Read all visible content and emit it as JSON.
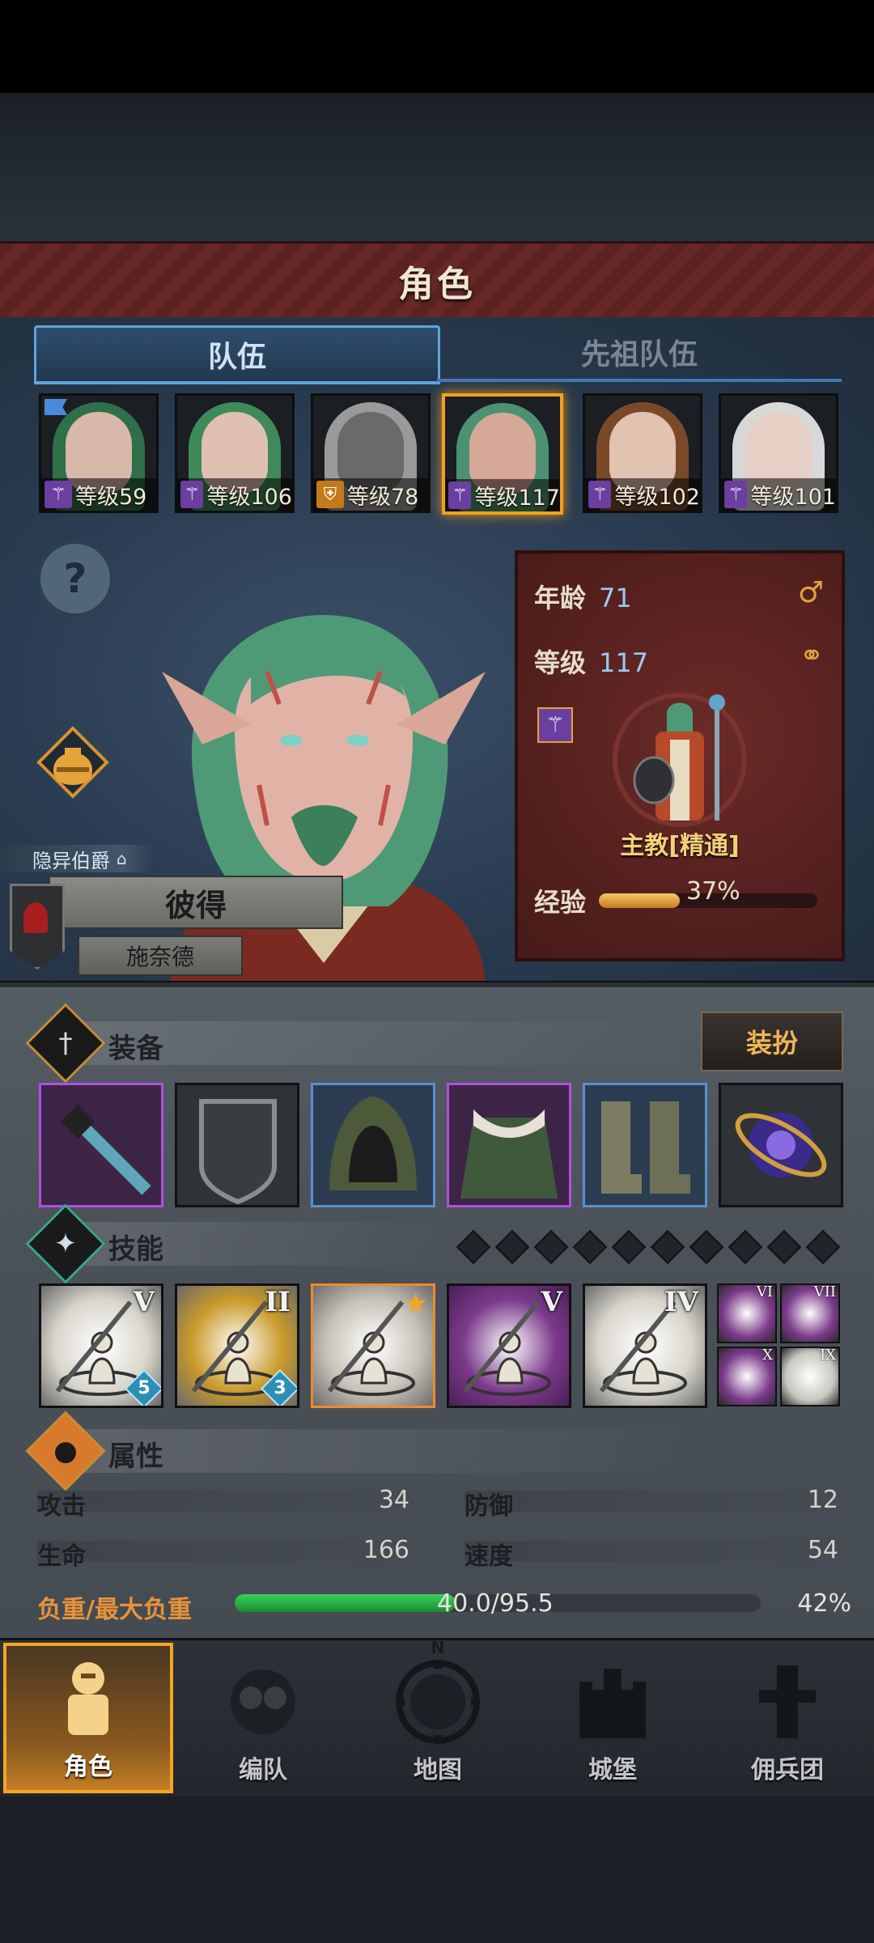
{
  "header": {
    "title": "角色"
  },
  "tabs": [
    {
      "label": "队伍",
      "active": true
    },
    {
      "label": "先祖队伍",
      "active": false
    }
  ],
  "party": [
    {
      "level": "等级59",
      "hair": "#2f6f4a",
      "skin": "#d8b8a8",
      "class": "staff",
      "flag": true
    },
    {
      "level": "等级106",
      "hair": "#3f8a5a",
      "skin": "#e0c0b0",
      "class": "staff-star"
    },
    {
      "level": "等级78",
      "hair": "#9a9a9a",
      "skin": "#6a6a6a",
      "class": "shield-star"
    },
    {
      "level": "等级117",
      "hair": "#4c9272",
      "skin": "#d6a898",
      "class": "staff-star",
      "selected": true
    },
    {
      "level": "等级102",
      "hair": "#7a4a28",
      "skin": "#e2c2b0",
      "class": "staff-star"
    },
    {
      "level": "等级101",
      "hair": "#d8d8d8",
      "skin": "#e6d0c6",
      "class": "staff-star"
    }
  ],
  "character": {
    "title": "隐异伯爵",
    "first_name": "彼得",
    "last_name": "施奈德",
    "age_label": "年龄",
    "age": "71",
    "level_label": "等级",
    "level": "117",
    "class_name": "主教[精通]",
    "exp_label": "经验",
    "exp_text": "37%",
    "exp_fraction": 0.37
  },
  "equipment": {
    "title": "装备",
    "dress_button": "装扮",
    "slots": [
      {
        "name": "staff",
        "rarity": "purple"
      },
      {
        "name": "shield",
        "rarity": "black"
      },
      {
        "name": "hood",
        "rarity": "blue"
      },
      {
        "name": "fur-coat",
        "rarity": "purple"
      },
      {
        "name": "boots",
        "rarity": "blue"
      },
      {
        "name": "orb-trinket",
        "rarity": "black"
      }
    ]
  },
  "skills": {
    "title": "技能",
    "items": [
      {
        "rank": "V",
        "badge": "5",
        "style": "silver"
      },
      {
        "rank": "II",
        "badge": "3",
        "style": "gold"
      },
      {
        "rank": "",
        "badge": "",
        "style": "orange-star"
      },
      {
        "rank": "V",
        "badge": "",
        "style": "purple"
      },
      {
        "rank": "IV",
        "badge": "",
        "style": "silver"
      }
    ],
    "mini": [
      {
        "rank": "VI"
      },
      {
        "rank": "VII"
      },
      {
        "rank": "X"
      },
      {
        "rank": "IX"
      }
    ]
  },
  "attributes": {
    "title": "属性",
    "attack_label": "攻击",
    "attack": "34",
    "defense_label": "防御",
    "defense": "12",
    "hp_label": "生命",
    "hp": "166",
    "speed_label": "速度",
    "speed": "54",
    "load_label": "负重/最大负重",
    "load_text": "40.0/95.5",
    "load_percent": "42%",
    "load_fraction": 0.42
  },
  "nav": [
    {
      "label": "角色",
      "icon": "knight-icon",
      "active": true
    },
    {
      "label": "编队",
      "icon": "formation-icon"
    },
    {
      "label": "地图",
      "icon": "compass-map-icon",
      "compass": "N"
    },
    {
      "label": "城堡",
      "icon": "castle-icon"
    },
    {
      "label": "佣兵团",
      "icon": "mercenary-icon"
    }
  ],
  "colors": {
    "accent": "#f4a621",
    "tab_blue": "#5ea4df",
    "banner": "#5a2220"
  }
}
